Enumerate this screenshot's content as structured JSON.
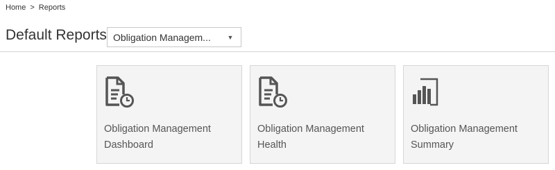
{
  "breadcrumb": {
    "home": "Home",
    "separator": ">",
    "current": "Reports"
  },
  "header": {
    "title": "Default Reports",
    "select": {
      "value": "Obligation Managem...",
      "caret_icon": "chevron-down-icon"
    }
  },
  "tiles": [
    {
      "icon": "report-document-clock-icon",
      "line1": "Obligation Management",
      "line2": "Dashboard"
    },
    {
      "icon": "report-document-clock-icon",
      "line1": "Obligation Management",
      "line2": "Health"
    },
    {
      "icon": "power-bi-icon",
      "line1": "Obligation Management",
      "line2": "Summary"
    }
  ],
  "colors": {
    "tile_background": "#f4f4f4",
    "tile_border": "#d6d6d6",
    "icon": "#555555",
    "text": "#333333"
  }
}
